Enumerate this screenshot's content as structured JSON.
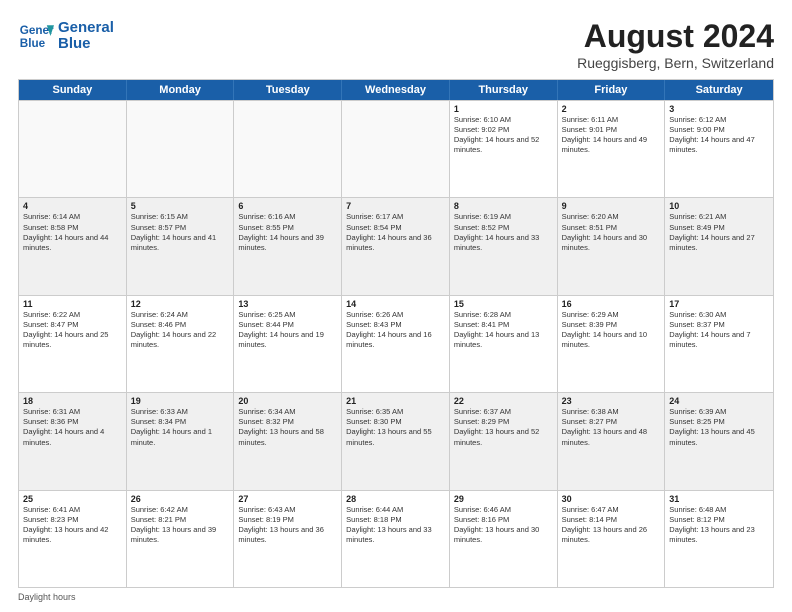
{
  "header": {
    "logo_line1": "General",
    "logo_line2": "Blue",
    "month_title": "August 2024",
    "subtitle": "Rueggisberg, Bern, Switzerland"
  },
  "weekdays": [
    "Sunday",
    "Monday",
    "Tuesday",
    "Wednesday",
    "Thursday",
    "Friday",
    "Saturday"
  ],
  "footer": {
    "note": "Daylight hours"
  },
  "rows": [
    [
      {
        "day": "",
        "empty": true
      },
      {
        "day": "",
        "empty": true
      },
      {
        "day": "",
        "empty": true
      },
      {
        "day": "",
        "empty": true
      },
      {
        "day": "1",
        "rise": "Sunrise: 6:10 AM",
        "set": "Sunset: 9:02 PM",
        "day_info": "Daylight: 14 hours and 52 minutes."
      },
      {
        "day": "2",
        "rise": "Sunrise: 6:11 AM",
        "set": "Sunset: 9:01 PM",
        "day_info": "Daylight: 14 hours and 49 minutes."
      },
      {
        "day": "3",
        "rise": "Sunrise: 6:12 AM",
        "set": "Sunset: 9:00 PM",
        "day_info": "Daylight: 14 hours and 47 minutes."
      }
    ],
    [
      {
        "day": "4",
        "rise": "Sunrise: 6:14 AM",
        "set": "Sunset: 8:58 PM",
        "day_info": "Daylight: 14 hours and 44 minutes.",
        "shaded": true
      },
      {
        "day": "5",
        "rise": "Sunrise: 6:15 AM",
        "set": "Sunset: 8:57 PM",
        "day_info": "Daylight: 14 hours and 41 minutes.",
        "shaded": true
      },
      {
        "day": "6",
        "rise": "Sunrise: 6:16 AM",
        "set": "Sunset: 8:55 PM",
        "day_info": "Daylight: 14 hours and 39 minutes.",
        "shaded": true
      },
      {
        "day": "7",
        "rise": "Sunrise: 6:17 AM",
        "set": "Sunset: 8:54 PM",
        "day_info": "Daylight: 14 hours and 36 minutes.",
        "shaded": true
      },
      {
        "day": "8",
        "rise": "Sunrise: 6:19 AM",
        "set": "Sunset: 8:52 PM",
        "day_info": "Daylight: 14 hours and 33 minutes.",
        "shaded": true
      },
      {
        "day": "9",
        "rise": "Sunrise: 6:20 AM",
        "set": "Sunset: 8:51 PM",
        "day_info": "Daylight: 14 hours and 30 minutes.",
        "shaded": true
      },
      {
        "day": "10",
        "rise": "Sunrise: 6:21 AM",
        "set": "Sunset: 8:49 PM",
        "day_info": "Daylight: 14 hours and 27 minutes.",
        "shaded": true
      }
    ],
    [
      {
        "day": "11",
        "rise": "Sunrise: 6:22 AM",
        "set": "Sunset: 8:47 PM",
        "day_info": "Daylight: 14 hours and 25 minutes."
      },
      {
        "day": "12",
        "rise": "Sunrise: 6:24 AM",
        "set": "Sunset: 8:46 PM",
        "day_info": "Daylight: 14 hours and 22 minutes."
      },
      {
        "day": "13",
        "rise": "Sunrise: 6:25 AM",
        "set": "Sunset: 8:44 PM",
        "day_info": "Daylight: 14 hours and 19 minutes."
      },
      {
        "day": "14",
        "rise": "Sunrise: 6:26 AM",
        "set": "Sunset: 8:43 PM",
        "day_info": "Daylight: 14 hours and 16 minutes."
      },
      {
        "day": "15",
        "rise": "Sunrise: 6:28 AM",
        "set": "Sunset: 8:41 PM",
        "day_info": "Daylight: 14 hours and 13 minutes."
      },
      {
        "day": "16",
        "rise": "Sunrise: 6:29 AM",
        "set": "Sunset: 8:39 PM",
        "day_info": "Daylight: 14 hours and 10 minutes."
      },
      {
        "day": "17",
        "rise": "Sunrise: 6:30 AM",
        "set": "Sunset: 8:37 PM",
        "day_info": "Daylight: 14 hours and 7 minutes."
      }
    ],
    [
      {
        "day": "18",
        "rise": "Sunrise: 6:31 AM",
        "set": "Sunset: 8:36 PM",
        "day_info": "Daylight: 14 hours and 4 minutes.",
        "shaded": true
      },
      {
        "day": "19",
        "rise": "Sunrise: 6:33 AM",
        "set": "Sunset: 8:34 PM",
        "day_info": "Daylight: 14 hours and 1 minute.",
        "shaded": true
      },
      {
        "day": "20",
        "rise": "Sunrise: 6:34 AM",
        "set": "Sunset: 8:32 PM",
        "day_info": "Daylight: 13 hours and 58 minutes.",
        "shaded": true
      },
      {
        "day": "21",
        "rise": "Sunrise: 6:35 AM",
        "set": "Sunset: 8:30 PM",
        "day_info": "Daylight: 13 hours and 55 minutes.",
        "shaded": true
      },
      {
        "day": "22",
        "rise": "Sunrise: 6:37 AM",
        "set": "Sunset: 8:29 PM",
        "day_info": "Daylight: 13 hours and 52 minutes.",
        "shaded": true
      },
      {
        "day": "23",
        "rise": "Sunrise: 6:38 AM",
        "set": "Sunset: 8:27 PM",
        "day_info": "Daylight: 13 hours and 48 minutes.",
        "shaded": true
      },
      {
        "day": "24",
        "rise": "Sunrise: 6:39 AM",
        "set": "Sunset: 8:25 PM",
        "day_info": "Daylight: 13 hours and 45 minutes.",
        "shaded": true
      }
    ],
    [
      {
        "day": "25",
        "rise": "Sunrise: 6:41 AM",
        "set": "Sunset: 8:23 PM",
        "day_info": "Daylight: 13 hours and 42 minutes."
      },
      {
        "day": "26",
        "rise": "Sunrise: 6:42 AM",
        "set": "Sunset: 8:21 PM",
        "day_info": "Daylight: 13 hours and 39 minutes."
      },
      {
        "day": "27",
        "rise": "Sunrise: 6:43 AM",
        "set": "Sunset: 8:19 PM",
        "day_info": "Daylight: 13 hours and 36 minutes."
      },
      {
        "day": "28",
        "rise": "Sunrise: 6:44 AM",
        "set": "Sunset: 8:18 PM",
        "day_info": "Daylight: 13 hours and 33 minutes."
      },
      {
        "day": "29",
        "rise": "Sunrise: 6:46 AM",
        "set": "Sunset: 8:16 PM",
        "day_info": "Daylight: 13 hours and 30 minutes."
      },
      {
        "day": "30",
        "rise": "Sunrise: 6:47 AM",
        "set": "Sunset: 8:14 PM",
        "day_info": "Daylight: 13 hours and 26 minutes."
      },
      {
        "day": "31",
        "rise": "Sunrise: 6:48 AM",
        "set": "Sunset: 8:12 PM",
        "day_info": "Daylight: 13 hours and 23 minutes."
      }
    ]
  ]
}
